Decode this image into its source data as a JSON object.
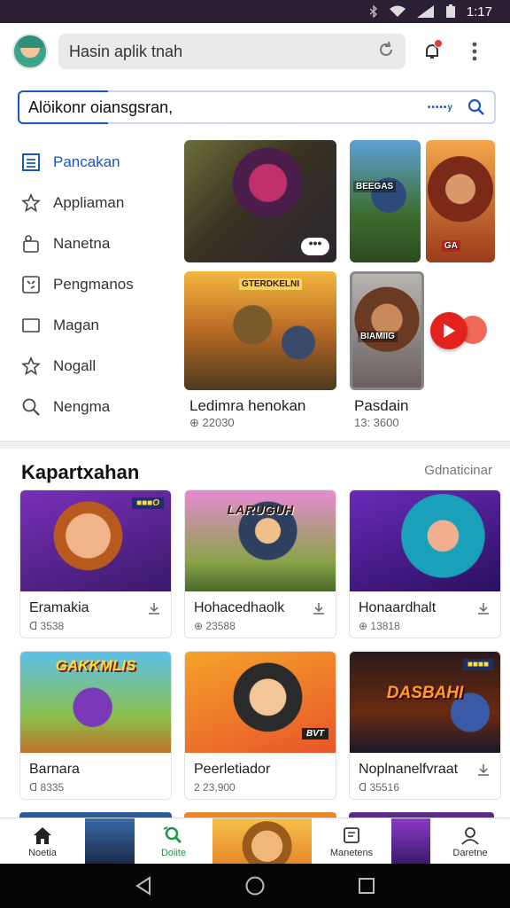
{
  "status_bar": {
    "time": "1:17"
  },
  "topbar": {
    "search_text": "Hasin aplik tnah"
  },
  "search": {
    "text": "Alöikonr oiansgsran,",
    "hint": "•••••y"
  },
  "side_nav": [
    {
      "label": "Pancakan",
      "icon": "list-icon"
    },
    {
      "label": "Appliaman",
      "icon": "star-outline-icon"
    },
    {
      "label": "Nanetna",
      "icon": "apps-icon"
    },
    {
      "label": "Pengmanos",
      "icon": "expand-icon"
    },
    {
      "label": "Magan",
      "icon": "square-icon"
    },
    {
      "label": "Nogall",
      "icon": "star-icon"
    },
    {
      "label": "Nengma",
      "icon": "search-icon"
    }
  ],
  "featured": [
    {
      "title": "Ledimra henokan",
      "meta": "⊕ 22030"
    },
    {
      "title": "Pasdain",
      "meta": "13: 3600"
    }
  ],
  "overlay_words": {
    "art2": "BEEGAS",
    "art3": "GA",
    "art4": "GTERDKELNI",
    "art5": "BIAMIIG"
  },
  "section": {
    "title": "Kapartxahan",
    "more": "Gdnaticinar"
  },
  "grid": [
    {
      "name": "Eramakia",
      "meta": "ᗡ 3538",
      "tag": "■■■O",
      "word": ""
    },
    {
      "name": "Hohacedhaolk",
      "meta": "⊕ 23588",
      "tag": "",
      "word": "LARUGUH"
    },
    {
      "name": "Honaardhalt",
      "meta": "⊕ 13818",
      "tag": "",
      "word": ""
    },
    {
      "name": "Barnara",
      "meta": "ᗡ 8335",
      "tag": "",
      "word": "GAKKMLIS"
    },
    {
      "name": "Peerletiador",
      "meta": "2 23,900",
      "tag": "BVT",
      "word": ""
    },
    {
      "name": "Noplnanelfvraat",
      "meta": "ᗡ 35516",
      "tag": "■■■■",
      "word": "DASBAHI"
    }
  ],
  "bottom_nav": [
    {
      "label": "Noetia",
      "icon": "home-icon"
    },
    {
      "label": "Doiite",
      "icon": "search-green-icon"
    },
    {
      "label": "Manetens",
      "icon": "library-icon"
    },
    {
      "label": "Daretne",
      "icon": "profile-icon"
    }
  ],
  "colors": {
    "accent": "#1a56c4",
    "status_bar": "#2a1f33",
    "play": "#e3211f"
  }
}
